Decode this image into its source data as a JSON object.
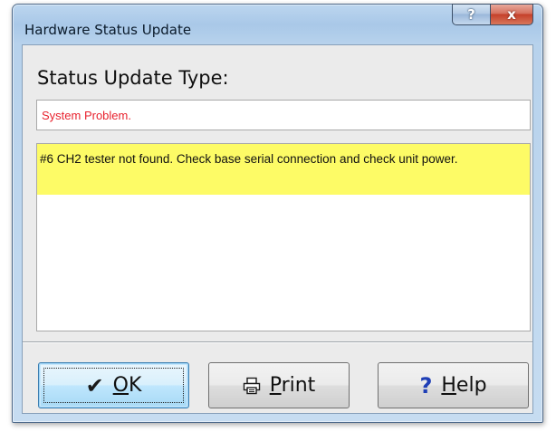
{
  "window": {
    "title": "Hardware Status Update",
    "help_glyph": "?",
    "close_glyph": "x"
  },
  "status": {
    "label": "Status Update Type:",
    "type_value": "System Problem.",
    "type_color": "#e8222e",
    "message": "#6  CH2 tester not found. Check base serial connection and check unit power.",
    "highlight_color": "#fdfb66"
  },
  "buttons": {
    "ok": {
      "icon": "check-icon",
      "glyph": "✔",
      "mnemonic": "O",
      "rest": "K"
    },
    "print": {
      "icon": "printer-icon",
      "mnemonic": "P",
      "rest": "rint"
    },
    "help": {
      "icon": "question-icon",
      "glyph": "?",
      "mnemonic": "H",
      "rest": "elp"
    }
  }
}
